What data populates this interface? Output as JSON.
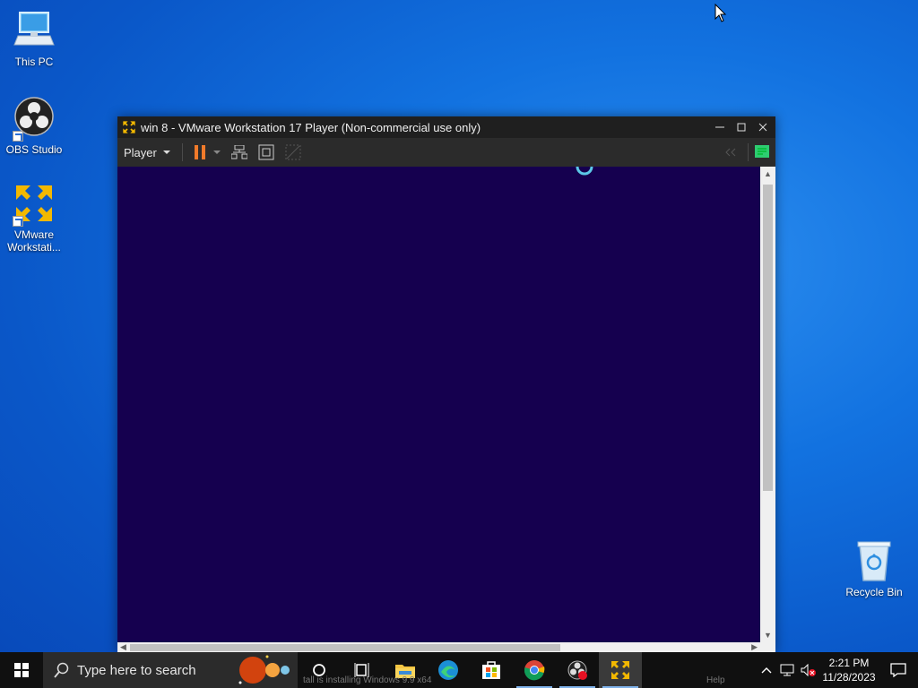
{
  "desktop": {
    "icons": [
      {
        "label": "This PC"
      },
      {
        "label": "OBS Studio"
      },
      {
        "label": "VMware\nWorkstati..."
      },
      {
        "label": "Recycle Bin"
      }
    ]
  },
  "window": {
    "title": "win 8 - VMware Workstation 17 Player (Non-commercial use only)",
    "player_menu": "Player",
    "guest_background": "#15004f"
  },
  "taskbar": {
    "search_placeholder": "Type here to search",
    "clock_time": "2:21 PM",
    "clock_date": "11/28/2023",
    "ghost_text": "tall is installing Windows 9.9 x64",
    "ghost_help": "Help"
  },
  "colors": {
    "accent": "#7fb2ea",
    "pause_orange": "#f07a2a",
    "vmware_yellow": "#f2b800"
  }
}
